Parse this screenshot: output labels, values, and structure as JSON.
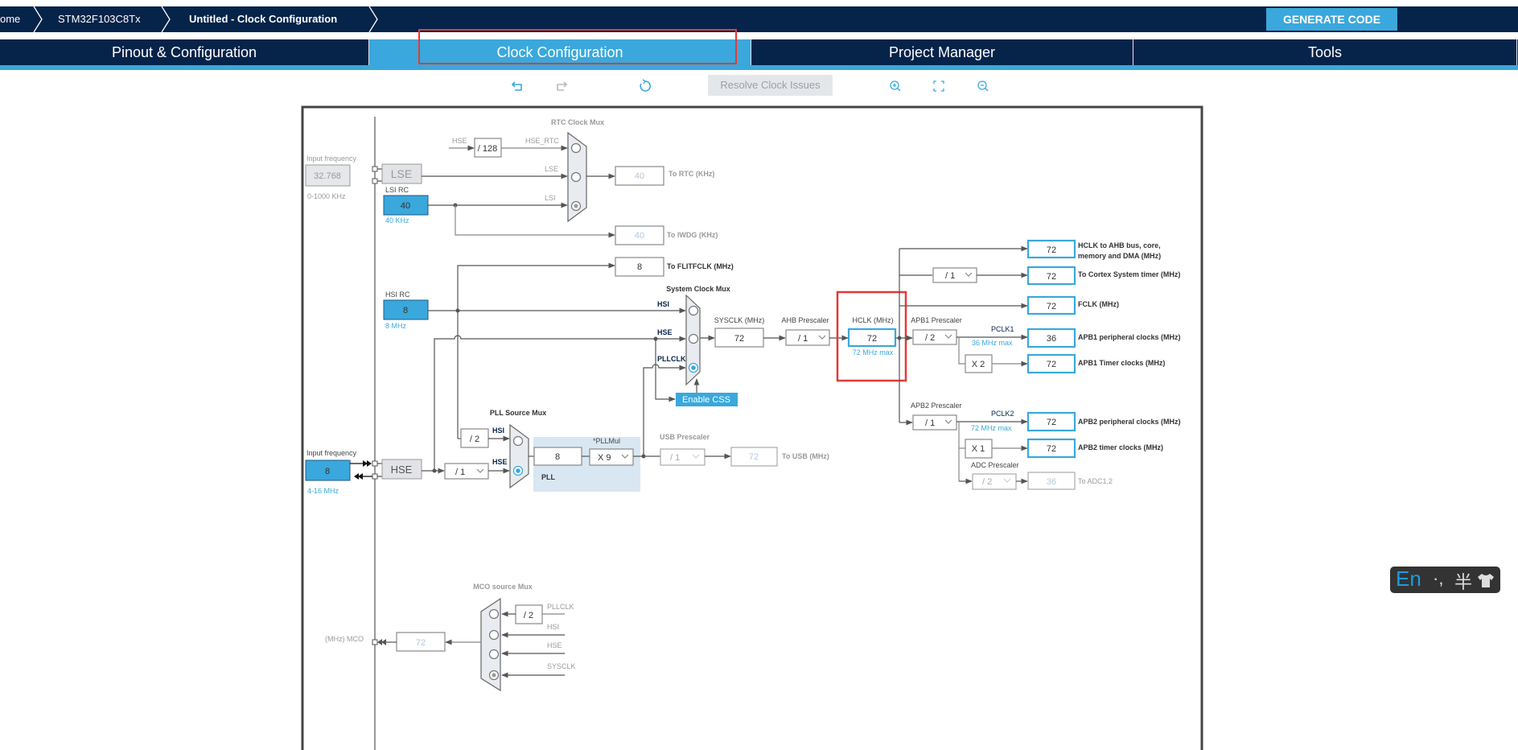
{
  "breadcrumb": {
    "home": "ome",
    "chip": "STM32F103C8Tx",
    "current": "Untitled - Clock Configuration"
  },
  "generate_label": "GENERATE CODE",
  "tabs": [
    "Pinout & Configuration",
    "Clock Configuration",
    "Project Manager",
    "Tools"
  ],
  "active_tab": "Clock Configuration",
  "toolbar": {
    "icons": [
      "undo-icon",
      "redo-icon",
      "refresh-icon",
      "zoom-in-icon",
      "fit-icon",
      "zoom-out-icon"
    ],
    "resolve": "Resolve Clock Issues"
  },
  "colors": {
    "navy": "#06234a",
    "accent": "#3aa8dc",
    "highlight": "#e53935"
  },
  "diagram": {
    "rtc": {
      "title": "RTC Clock Mux",
      "hse_in": "HSE",
      "div128": "/ 128",
      "hse_rtc": "HSE_RTC",
      "lse_in": "LSE",
      "lsi_in": "LSI",
      "out_value": "40",
      "out_label": "To RTC (KHz)",
      "selected": "LSI"
    },
    "lse": {
      "input_label": "Input frequency",
      "value": "32.768",
      "range": "0-1000 KHz",
      "block": "LSE"
    },
    "lsi": {
      "label": "LSI RC",
      "value": "40",
      "freq": "40 KHz"
    },
    "iwdg": {
      "value": "40",
      "label": "To IWDG (KHz)"
    },
    "flit": {
      "value": "8",
      "label": "To FLITFCLK (MHz)"
    },
    "hsi": {
      "label": "HSI RC",
      "value": "8",
      "freq": "8 MHz"
    },
    "sysmux": {
      "title": "System Clock Mux",
      "hsi": "HSI",
      "hse": "HSE",
      "pllclk": "PLLCLK",
      "selected": "PLLCLK"
    },
    "css": "Enable CSS",
    "sysclk": {
      "label": "SYSCLK (MHz)",
      "value": "72"
    },
    "ahb": {
      "label": "AHB Prescaler",
      "value": "/ 1"
    },
    "hclk": {
      "label": "HCLK (MHz)",
      "value": "72",
      "max": "72 MHz max"
    },
    "cortex_div": "/ 1",
    "outputs": {
      "ahb": {
        "value": "72",
        "label1": "HCLK to AHB bus, core,",
        "label2": "memory and DMA (MHz)"
      },
      "cortex": {
        "value": "72",
        "label": "To Cortex System timer (MHz)"
      },
      "fclk": {
        "value": "72",
        "label": "FCLK (MHz)"
      },
      "apb1p": {
        "value": "36",
        "label": "APB1 peripheral clocks (MHz)"
      },
      "apb1t": {
        "value": "72",
        "label": "APB1 Timer clocks (MHz)"
      },
      "apb2p": {
        "value": "72",
        "label": "APB2 peripheral clocks (MHz)"
      },
      "apb2t": {
        "value": "72",
        "label": "APB2 timer clocks (MHz)"
      }
    },
    "apb1": {
      "label": "APB1 Prescaler",
      "value": "/ 2",
      "pclk": "PCLK1",
      "max": "36 MHz max",
      "timer_mul": "X 2"
    },
    "apb2": {
      "label": "APB2 Prescaler",
      "value": "/ 1",
      "pclk": "PCLK2",
      "max": "72 MHz max",
      "timer_mul": "X 1"
    },
    "adc": {
      "label": "ADC Prescaler",
      "value": "/ 2",
      "out": "36",
      "out_label": "To ADC1,2"
    },
    "hse": {
      "input_label": "Input frequency",
      "value": "8",
      "range": "4-16 MHz",
      "block": "HSE",
      "div": "/ 1"
    },
    "pllsrc": {
      "title": "PLL Source Mux",
      "div2": "/ 2",
      "hsi": "HSI",
      "hse": "HSE",
      "selected": "HSE"
    },
    "pll": {
      "value": "8",
      "mul_label": "*PLLMul",
      "mul": "X 9",
      "label": "PLL"
    },
    "usb": {
      "label": "USB Prescaler",
      "value": "/ 1",
      "out": "72",
      "out_label": "To USB (MHz)"
    },
    "mco": {
      "title": "MCO source Mux",
      "div2": "/ 2",
      "pllclk": "PLLCLK",
      "hsi": "HSI",
      "hse": "HSE",
      "sysclk": "SYSCLK",
      "value": "72",
      "label": "(MHz) MCO",
      "selected": "SYSCLK"
    }
  },
  "ime": {
    "lang": "En",
    "punct": "·,",
    "width": "半",
    "skin_icon": "shirt-icon"
  }
}
